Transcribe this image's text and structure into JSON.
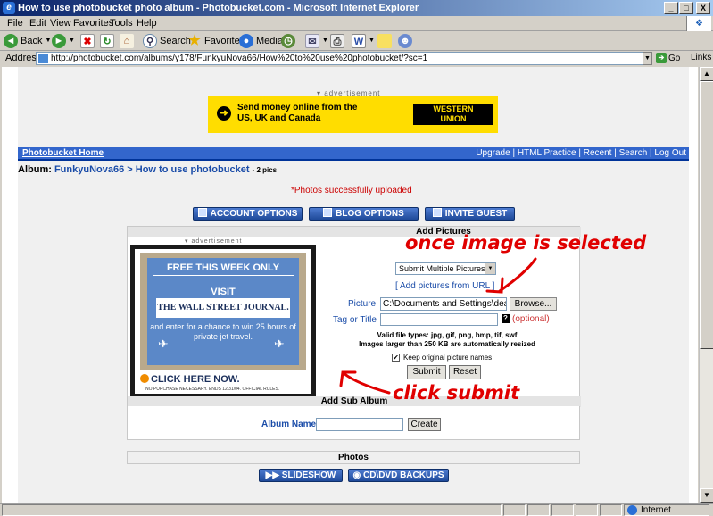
{
  "window": {
    "title": "How to use photobucket photo album - Photobucket.com - Microsoft Internet Explorer",
    "min": "_",
    "max": "□",
    "close": "X"
  },
  "menu": [
    "File",
    "Edit",
    "View",
    "Favorites",
    "Tools",
    "Help"
  ],
  "toolbar": {
    "back": "Back",
    "search": "Search",
    "favorites": "Favorites",
    "media": "Media"
  },
  "address": {
    "label": "Address",
    "url": "http://photobucket.com/albums/y178/FunkyuNova66/How%20to%20use%20photobucket/?sc=1",
    "go": "Go",
    "links": "Links"
  },
  "status": {
    "zone": "Internet"
  },
  "page": {
    "ad_label": "▾ advertisement",
    "wu_ad": {
      "text": "Send money online from the US, UK and Canada",
      "logo_line1": "WESTERN",
      "logo_line2": "UNION"
    },
    "nav": {
      "home": "Photobucket Home",
      "links": "Upgrade | HTML Practice | Recent | Search | Log Out"
    },
    "album": {
      "prefix": "Album:",
      "owner": "FunkyuNova66",
      "sep": ">",
      "name": "How to use photobucket",
      "count": "- 2 pics"
    },
    "success": "*Photos successfully uploaded",
    "buttons": {
      "account": "ACCOUNT OPTIONS",
      "blog": "BLOG OPTIONS",
      "invite": "INVITE GUEST"
    },
    "add_pictures": {
      "header": "Add Pictures",
      "ad_label": "▾ advertisement",
      "select_value": "Submit Multiple Pictures",
      "url_link_open": "[",
      "url_link": "Add pictures from URL",
      "url_link_close": "]",
      "picture_label": "Picture",
      "picture_value": "C:\\Documents and Settings\\dead",
      "browse": "Browse...",
      "tag_label": "Tag or Title",
      "help": "?",
      "optional": "(optional)",
      "valid_types": "Valid file types: jpg, gif, png, bmp, tif, swf",
      "size_note": "Images larger than 250 KB are automatically resized",
      "keep_check": "✔",
      "keep_label": "Keep original picture names",
      "submit": "Submit",
      "reset": "Reset"
    },
    "wsj_ad": {
      "headline": "FREE THIS WEEK ONLY",
      "visit": "VISIT",
      "paper": "THE WALL STREET JOURNAL.",
      "body": "and enter for a chance to win 25 hours of private jet travel.",
      "cta": "CLICK HERE NOW.",
      "fine": "NO PURCHASE NECESSARY. ENDS 12/31/04. OFFICIAL RULES."
    },
    "sub_album": {
      "header": "Add Sub Album",
      "label": "Album Name",
      "create": "Create"
    },
    "photos": {
      "header": "Photos",
      "slideshow": "SLIDESHOW",
      "backups": "CD\\DVD BACKUPS"
    }
  },
  "annotations": {
    "selected": "once image is selected",
    "submit": "click submit"
  },
  "colors": {
    "annotation": "#e00000",
    "nav_bar": "#3366cc",
    "link": "#1a4ca8",
    "success": "#cc0000"
  }
}
